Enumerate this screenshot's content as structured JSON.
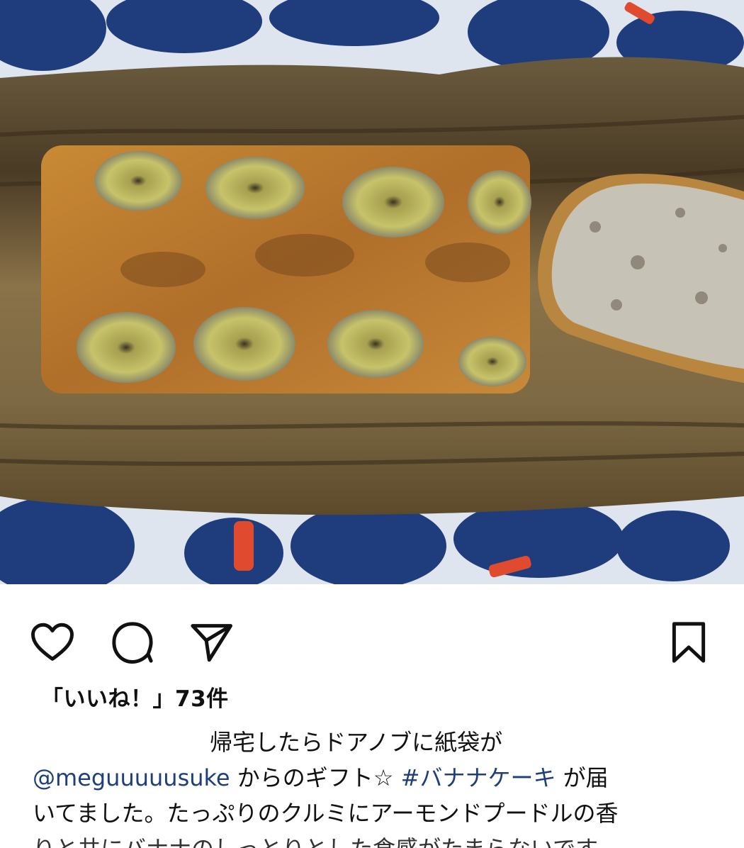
{
  "post": {
    "image_alt": "バナナケーキ",
    "likes_text": "「いいね！」73件",
    "caption": {
      "line1": "帰宅したらドアノブに紙袋が",
      "mention": "@meguuuuusuke",
      "mid_text": " からのギフト☆ ",
      "hashtag": "#バナナケーキ",
      "tail_text": " が届",
      "line3": "いてました。たっぷりのクルミにアーモンドプードルの香",
      "line4_partial": "りと共にバナナのしっとりとした食感がたまらないです。"
    }
  },
  "icons": {
    "like": "heart-icon",
    "comment": "comment-bubble-icon",
    "share": "paper-plane-icon",
    "save": "bookmark-icon"
  },
  "colors": {
    "link": "#1f3f7a",
    "text": "#111111"
  }
}
